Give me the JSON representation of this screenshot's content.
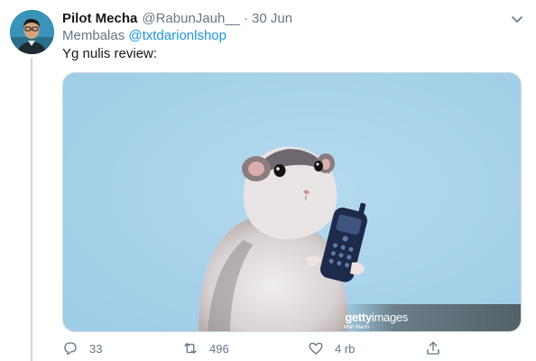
{
  "tweet": {
    "display_name": "Pilot Mecha",
    "handle": "@RabunJauh__",
    "separator": "·",
    "date": "30 Jun",
    "reply_prefix": "Membalas",
    "reply_mention": "@txtdarionlshop",
    "text": "Yg nulis review:"
  },
  "media": {
    "watermark_brand": "getty",
    "watermark_brand_suffix": "images",
    "watermark_credit": "Mon Maon"
  },
  "actions": {
    "replies": "33",
    "retweets": "496",
    "likes": "4 rb"
  },
  "icons": {
    "reply": "reply-icon",
    "retweet": "retweet-icon",
    "like": "heart-icon",
    "share": "share-icon",
    "more": "chevron-down-icon"
  },
  "colors": {
    "link": "#1b95e0",
    "muted": "#657786",
    "photo_background": "#a9d3ea"
  }
}
